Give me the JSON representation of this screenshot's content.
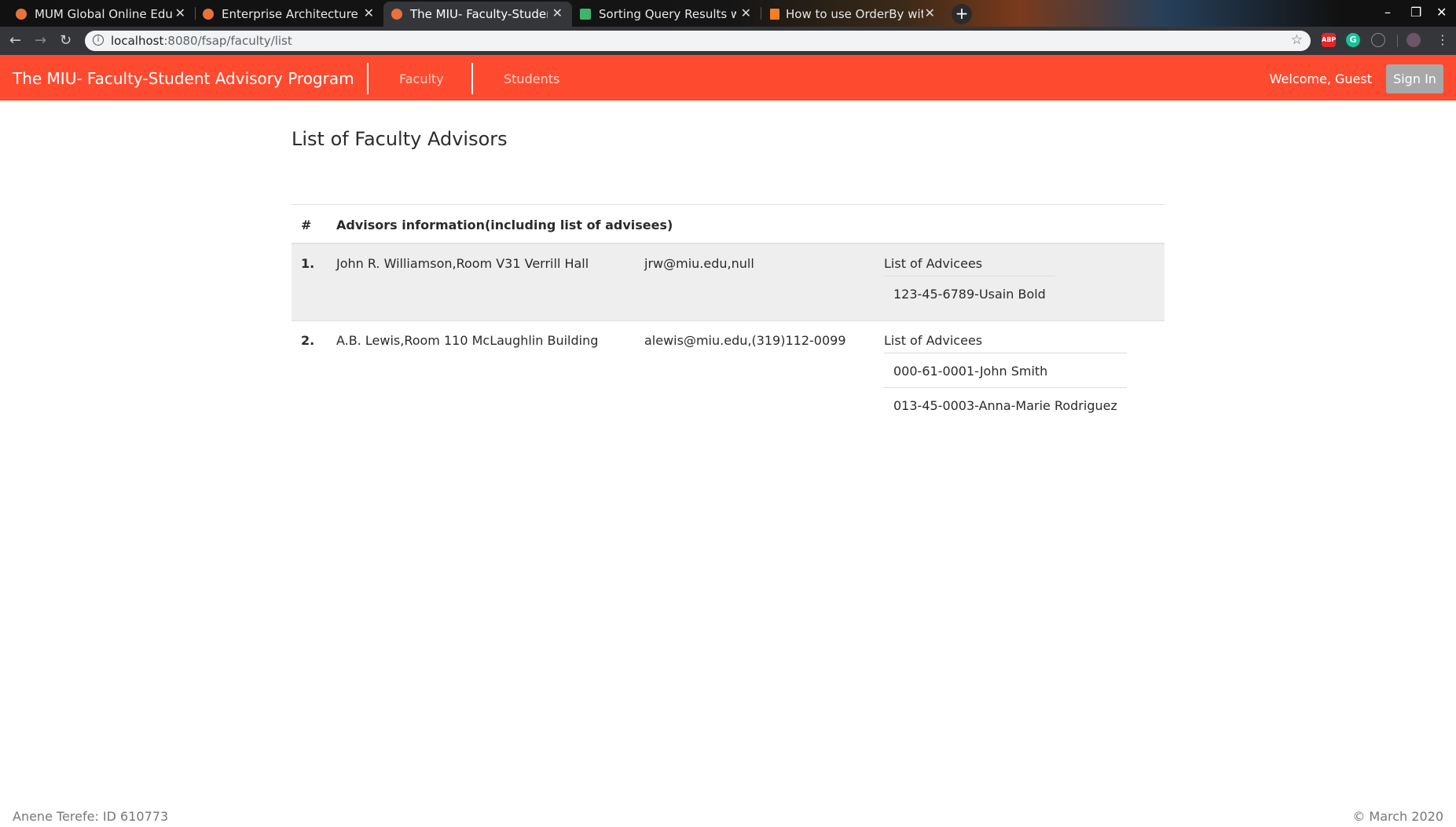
{
  "browser": {
    "tabs": [
      {
        "title": "MUM Global Online Educa",
        "favicon": "mum-icon"
      },
      {
        "title": "Enterprise Architecture",
        "favicon": "mum-icon"
      },
      {
        "title": "The MIU- Faculty-Student",
        "favicon": "mum-icon"
      },
      {
        "title": "Sorting Query Results wit",
        "favicon": "spring-icon"
      },
      {
        "title": "How to use OrderBy with",
        "favicon": "stackoverflow-icon"
      }
    ],
    "url_host": "localhost",
    "url_path": ":8080/fsap/faculty/list",
    "extensions": {
      "abp": "ABP",
      "grammarly": "G"
    }
  },
  "app": {
    "brand": "The MIU- Faculty-Student Advisory Program",
    "nav": {
      "faculty": "Faculty",
      "students": "Students"
    },
    "welcome": "Welcome, Guest",
    "sign_in": "Sign In",
    "accent_color": "#fe4b30"
  },
  "main": {
    "title": "List of Faculty Advisors",
    "table": {
      "headers": {
        "num": "#",
        "info": "Advisors information(including list of advisees)"
      },
      "rows": [
        {
          "num": "1.",
          "name": "John R. Williamson,Room V31 Verrill Hall",
          "contact": "jrw@miu.edu,null",
          "advisees_label": "List of Advicees",
          "advisees": [
            "123-45-6789-Usain Bold"
          ]
        },
        {
          "num": "2.",
          "name": "A.B. Lewis,Room 110 McLaughlin Building",
          "contact": "alewis@miu.edu,(319)112-0099",
          "advisees_label": "List of Advicees",
          "advisees": [
            "000-61-0001-John Smith",
            "013-45-0003-Anna-Marie Rodriguez"
          ]
        }
      ]
    }
  },
  "footer": {
    "left": "Anene Terefe: ID 610773",
    "right": "© March 2020"
  }
}
